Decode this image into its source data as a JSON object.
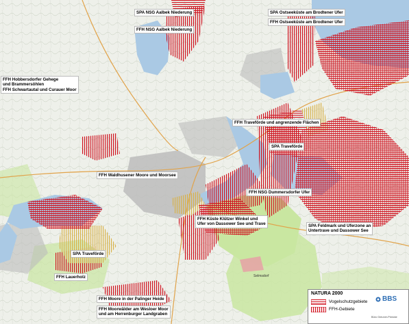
{
  "map": {
    "labels": [
      {
        "id": "spa-aalbek",
        "text": "SPA NSG Aalbek Niederung"
      },
      {
        "id": "ffh-aalbek",
        "text": "FFH NSG Aalbek Niederung"
      },
      {
        "id": "spa-ostsee",
        "text": "SPA Ostseeküste am Brodtener Ufer"
      },
      {
        "id": "ffh-ostsee",
        "text": "FFH Ostseeküste am Brodtener Ufer"
      },
      {
        "id": "ffh-hobbersdorf",
        "lines": [
          "FFH Hobbersdorfer Gehege",
          "und Brammersöhlen",
          "FFH Schwartautal und Curauer Moor"
        ]
      },
      {
        "id": "ffh-travefoerde-flaechen",
        "text": "FFH Traveförde und angrenzende Flächen"
      },
      {
        "id": "spa-travefoerde-east",
        "text": "SPA Traveförde"
      },
      {
        "id": "ffh-waldhusen",
        "text": "FFH Waldhusener Moore und Moorsee"
      },
      {
        "id": "ffh-dummersdorf",
        "text": "FFH NSG Dummersdorfer Ufer"
      },
      {
        "id": "ffh-kluetzer",
        "lines": [
          "FFH Küste Klützer Winkel und",
          "Ufer von Dassower See und Trave"
        ]
      },
      {
        "id": "spa-feldmark",
        "lines": [
          "SPA Feldmark und Uferzone an",
          "Untertrave und Dassower See"
        ]
      },
      {
        "id": "spa-travefoerde-west",
        "text": "SPA Traveförde"
      },
      {
        "id": "ffh-lauerholz",
        "text": "FFH Lauerholz"
      },
      {
        "id": "ffh-palingen",
        "text": "FFH Moore in der Palinger Heide"
      },
      {
        "id": "ffh-wesloe",
        "lines": [
          "FFH Moorwälder am Wesloer Moor",
          "und am Herrenburger Landgraben"
        ]
      }
    ],
    "place_label": "Selmsdorf"
  },
  "legend": {
    "title": "NATURA 2000",
    "items": [
      {
        "label": "Vogelschutzgebiete",
        "pattern": "horizontal"
      },
      {
        "label": "FFH-Gebiete",
        "pattern": "vertical"
      }
    ]
  },
  "logo": {
    "text": "BBS",
    "subtitle": "Büro Greuner-Pönicke"
  },
  "colors": {
    "hatch": "#d0121f",
    "water": "#aac9e4",
    "forest": "#c9e6a1",
    "urban": "#bcbcbc",
    "background": "#eef0ea"
  }
}
